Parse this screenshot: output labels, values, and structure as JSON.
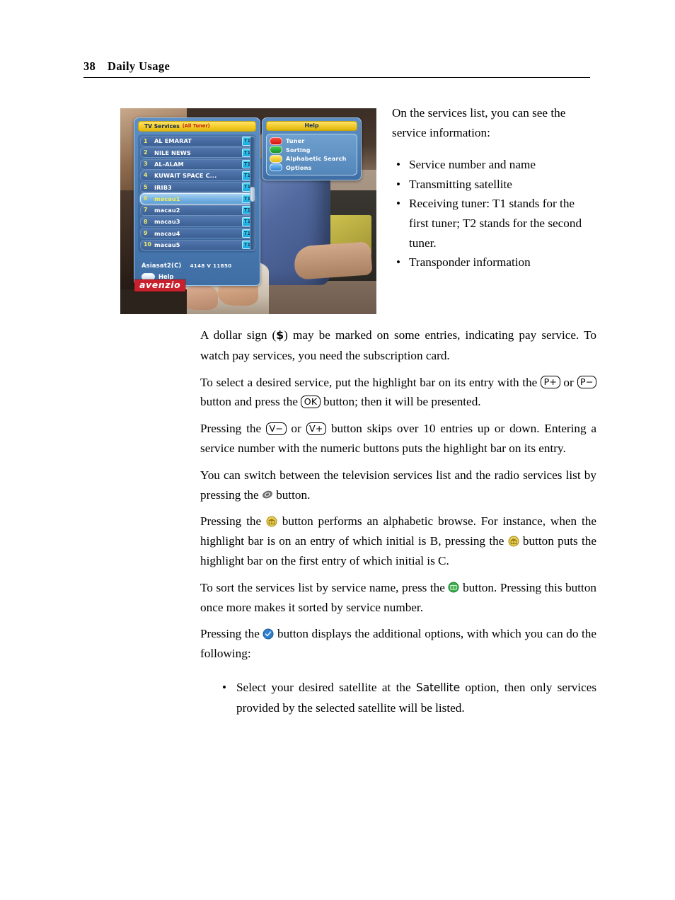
{
  "header": {
    "page_number": "38",
    "chapter": "Daily Usage"
  },
  "figure": {
    "osd": {
      "services_panel": {
        "title": "TV Services",
        "title_suffix": "(All Tuner)",
        "rows": [
          {
            "number": "1",
            "name": "AL EMARAT",
            "tuner": "T1",
            "selected": false
          },
          {
            "number": "2",
            "name": "NILE NEWS",
            "tuner": "T1",
            "selected": false
          },
          {
            "number": "3",
            "name": "AL-ALAM",
            "tuner": "T1",
            "selected": false
          },
          {
            "number": "4",
            "name": "KUWAIT SPACE C...",
            "tuner": "T1",
            "selected": false
          },
          {
            "number": "5",
            "name": "IRIB3",
            "tuner": "T1",
            "selected": false
          },
          {
            "number": "6",
            "name": "macau1",
            "tuner": "T1",
            "selected": true
          },
          {
            "number": "7",
            "name": "macau2",
            "tuner": "T1",
            "selected": false
          },
          {
            "number": "8",
            "name": "macau3",
            "tuner": "T1",
            "selected": false
          },
          {
            "number": "9",
            "name": "macau4",
            "tuner": "T1",
            "selected": false
          },
          {
            "number": "10",
            "name": "macau5",
            "tuner": "T1",
            "selected": false
          }
        ],
        "status_satellite": "Asiasat2(C)",
        "status_transponder": "4148 V 11850",
        "help_label": "Help"
      },
      "help_panel": {
        "title": "Help",
        "items": [
          {
            "label": "Tuner",
            "color": "#e02020"
          },
          {
            "label": "Sorting",
            "color": "#20b030"
          },
          {
            "label": "Alphabetic Search",
            "color": "#f0d13a"
          },
          {
            "label": "Options",
            "color": "#4f9fe0"
          }
        ]
      }
    },
    "logo": "avenzio"
  },
  "right_column": {
    "intro": "On the services list, you can see the service information:",
    "bullets": [
      "Service number and name",
      "Transmitting satellite",
      "Receiving tuner: T1 stands for the first tuner; T2 stands for the second tuner.",
      "Transponder information"
    ]
  },
  "body": {
    "p1_a": "A dollar sign (",
    "p1_dollar": "$",
    "p1_b": ") may be marked on some entries, indicating pay service. To watch pay services, you need the subscription card.",
    "p2_a": "To select a desired service, put the highlight bar on its entry with the",
    "p2_key1": "P+",
    "p2_b": "or",
    "p2_key2": "P−",
    "p2_c": "button and press the",
    "p2_key3": "OK",
    "p2_d": "button; then it will be presented.",
    "p3_a": "Pressing the",
    "p3_key1": "V−",
    "p3_b": "or",
    "p3_key2": "V+",
    "p3_c": "button skips over 10 entries up or down. Entering a service number with the numeric buttons puts the highlight bar on its entry.",
    "p4_a": "You can switch between the television services list and the radio services list by pressing the",
    "p4_b": "button.",
    "p5_a": "Pressing the",
    "p5_b": "button performs an alphabetic browse.  For instance, when the highlight bar is on an entry of which initial is B, pressing the",
    "p5_c": "button puts the highlight bar on the first entry of which initial is C.",
    "p6_a": "To sort the services list by service name, press the",
    "p6_b": "button. Pressing this button once more makes it sorted by service number.",
    "p7_a": "Pressing the",
    "p7_b": "button displays the additional options, with which you can do the following:",
    "option_bullet_a": "Select your desired satellite at the",
    "option_bullet_satellite": "Satellite",
    "option_bullet_b": "option, then only services provided by the selected satellite will be listed."
  },
  "colors": {
    "osd_yellow": "#f5cf2c",
    "osd_blue": "#4b7db4",
    "tuner_badge": "#16a8e0",
    "highlight_text": "#f3f04e",
    "logo_red": "#c8202c",
    "btn_yellow": "#e8ce52",
    "btn_green": "#3cae4e",
    "btn_blue": "#2f7fd0"
  },
  "icons": {
    "tv_radio_toggle": "tv-radio-toggle-icon",
    "alphabetic_search": "alphabetic-search-button-icon",
    "sorting": "sorting-button-icon",
    "options": "options-button-icon"
  }
}
